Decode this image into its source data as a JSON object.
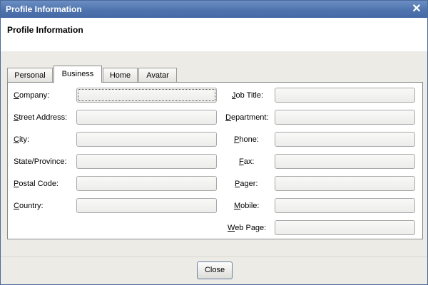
{
  "window": {
    "title": "Profile Information"
  },
  "header": {
    "title": "Profile Information"
  },
  "tabs": [
    {
      "label": "Personal",
      "active": false
    },
    {
      "label": "Business",
      "active": true
    },
    {
      "label": "Home",
      "active": false
    },
    {
      "label": "Avatar",
      "active": false
    }
  ],
  "form": {
    "left": [
      {
        "label": "Company:",
        "mnemonic": "C",
        "value": ""
      },
      {
        "label": "Street Address:",
        "mnemonic": "S",
        "value": ""
      },
      {
        "label": "City:",
        "mnemonic": "C",
        "value": ""
      },
      {
        "label": "State/Province:",
        "mnemonic": "",
        "value": ""
      },
      {
        "label": "Postal Code:",
        "mnemonic": "P",
        "value": ""
      },
      {
        "label": "Country:",
        "mnemonic": "C",
        "value": ""
      }
    ],
    "right": [
      {
        "label": "Job Title:",
        "mnemonic": "J",
        "value": ""
      },
      {
        "label": "Department:",
        "mnemonic": "D",
        "value": ""
      },
      {
        "label": "Phone:",
        "mnemonic": "P",
        "value": ""
      },
      {
        "label": "Fax:",
        "mnemonic": "F",
        "value": ""
      },
      {
        "label": "Pager:",
        "mnemonic": "P",
        "value": ""
      },
      {
        "label": "Mobile:",
        "mnemonic": "M",
        "value": ""
      },
      {
        "label": "Web Page:",
        "mnemonic": "W",
        "value": ""
      }
    ]
  },
  "footer": {
    "close_label": "Close"
  }
}
